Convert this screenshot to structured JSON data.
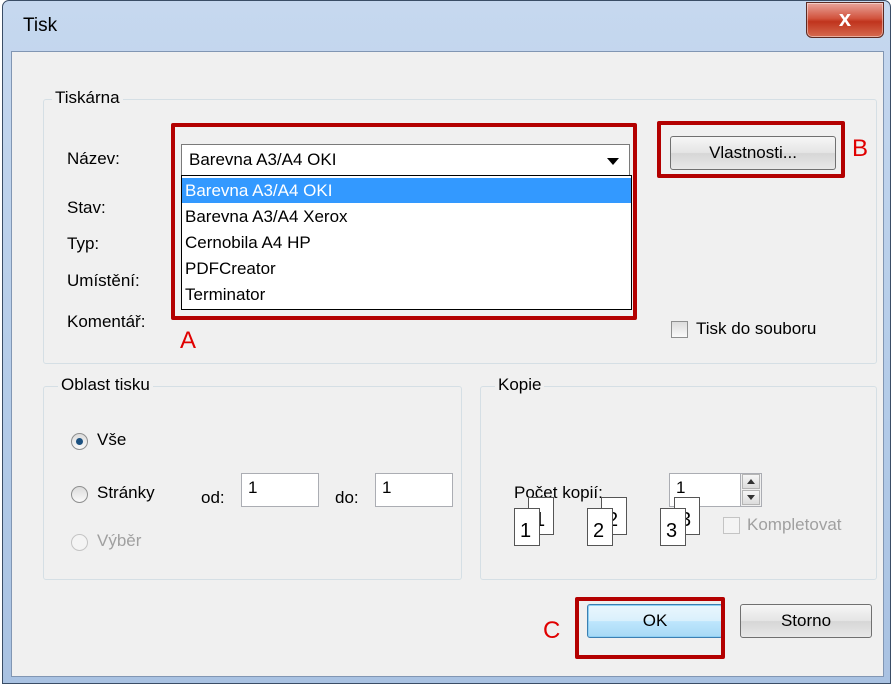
{
  "window": {
    "title": "Tisk",
    "close_glyph": "x"
  },
  "printer_group": {
    "label": "Tiskárna",
    "name_label": "Název:",
    "status_label": "Stav:",
    "type_label": "Typ:",
    "location_label": "Umístění:",
    "comment_label": "Komentář:",
    "selected_printer": "Barevna A3/A4 OKI",
    "options": [
      "Barevna A3/A4 OKI",
      "Barevna A3/A4 Xerox",
      "Cernobila A4 HP",
      "PDFCreator",
      "Terminator"
    ],
    "properties_button": "Vlastnosti...",
    "print_to_file_label": "Tisk do souboru"
  },
  "print_range": {
    "label": "Oblast tisku",
    "all_label": "Vše",
    "pages_label": "Stránky",
    "from_label": "od:",
    "from_value": "1",
    "to_label": "do:",
    "to_value": "1",
    "selection_label": "Výběr"
  },
  "copies": {
    "label": "Kopie",
    "count_label": "Počet kopií:",
    "count_value": "1",
    "collate_label": "Kompletovat",
    "collate_pages": [
      "1",
      "1",
      "2",
      "2",
      "3",
      "3"
    ]
  },
  "buttons": {
    "ok": "OK",
    "cancel": "Storno"
  },
  "annotations": {
    "a": "A",
    "b": "B",
    "c": "C",
    "color": "#b30000"
  }
}
